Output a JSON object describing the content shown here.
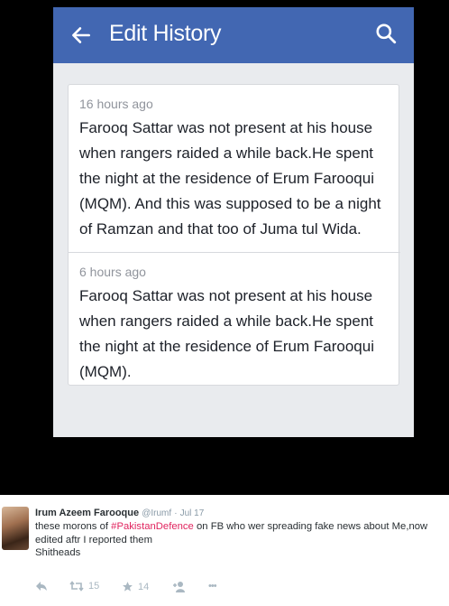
{
  "app": {
    "title": "Edit History"
  },
  "edits": [
    {
      "time": "16 hours ago",
      "text": "Farooq Sattar was not present at his house when rangers raided a while back.He spent the night at the residence of Erum Farooqui (MQM). And this was supposed to be a night of Ramzan and that too of Juma tul Wida."
    },
    {
      "time": "6 hours ago",
      "text": "Farooq Sattar was not present at his house when rangers raided a while back.He spent the night at the residence of Erum Farooqui (MQM)."
    }
  ],
  "tweet": {
    "name": "Irum Azeem Farooque",
    "handle": "@Irumf",
    "separator": "·",
    "date": "Jul 17",
    "text_before": "these morons of ",
    "hashtag": "#PakistanDefence",
    "text_after": " on FB who wer spreading fake news about Me,now edited aftr I reported them",
    "text_line2": "Shitheads",
    "retweets": "15",
    "favorites": "14",
    "more": "•••"
  },
  "icons": {
    "back": "arrow-left-icon",
    "search": "search-icon",
    "reply": "reply-icon",
    "retweet": "retweet-icon",
    "favorite": "star-icon",
    "follow": "add-user-icon",
    "more": "more-icon"
  },
  "colors": {
    "appbar": "#4267b2",
    "background": "#e9ebee",
    "hashtag": "#e0245e"
  }
}
